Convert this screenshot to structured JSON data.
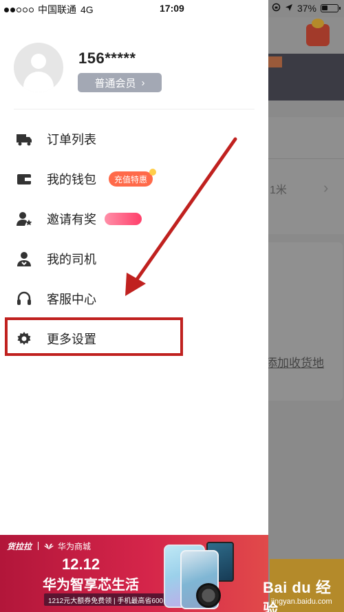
{
  "status_bar": {
    "carrier": "中国联通",
    "network": "4G",
    "time": "17:09",
    "battery": "37%",
    "battery_level": 0.37
  },
  "profile": {
    "phone": "156*****",
    "member_label": "普通会员",
    "member_chevron": "›"
  },
  "menu": {
    "items": [
      {
        "label": "订单列表",
        "icon": "truck-icon"
      },
      {
        "label": "我的钱包",
        "icon": "wallet-icon",
        "badge": "充值特惠"
      },
      {
        "label": "邀请有奖",
        "icon": "invite-user-icon"
      },
      {
        "label": "我的司机",
        "icon": "driver-icon"
      },
      {
        "label": "客服中心",
        "icon": "headset-icon"
      },
      {
        "label": "更多设置",
        "icon": "gear-icon"
      }
    ]
  },
  "banner": {
    "brand": "货拉拉",
    "partner": "华为商城",
    "date": "12.12",
    "slogan": "华为智享芯生活",
    "offer": "1212元大额券免费领 | 手机最高省600"
  },
  "background": {
    "distance_suffix": "1米",
    "add_address_link": "添加收货地"
  },
  "watermark": {
    "main": "Bai du 经验",
    "sub": "jingyan.baidu.com"
  },
  "colors": {
    "highlight": "#c0211f",
    "promo": "#ff6a4a",
    "member_badge": "#a3a8b4"
  }
}
